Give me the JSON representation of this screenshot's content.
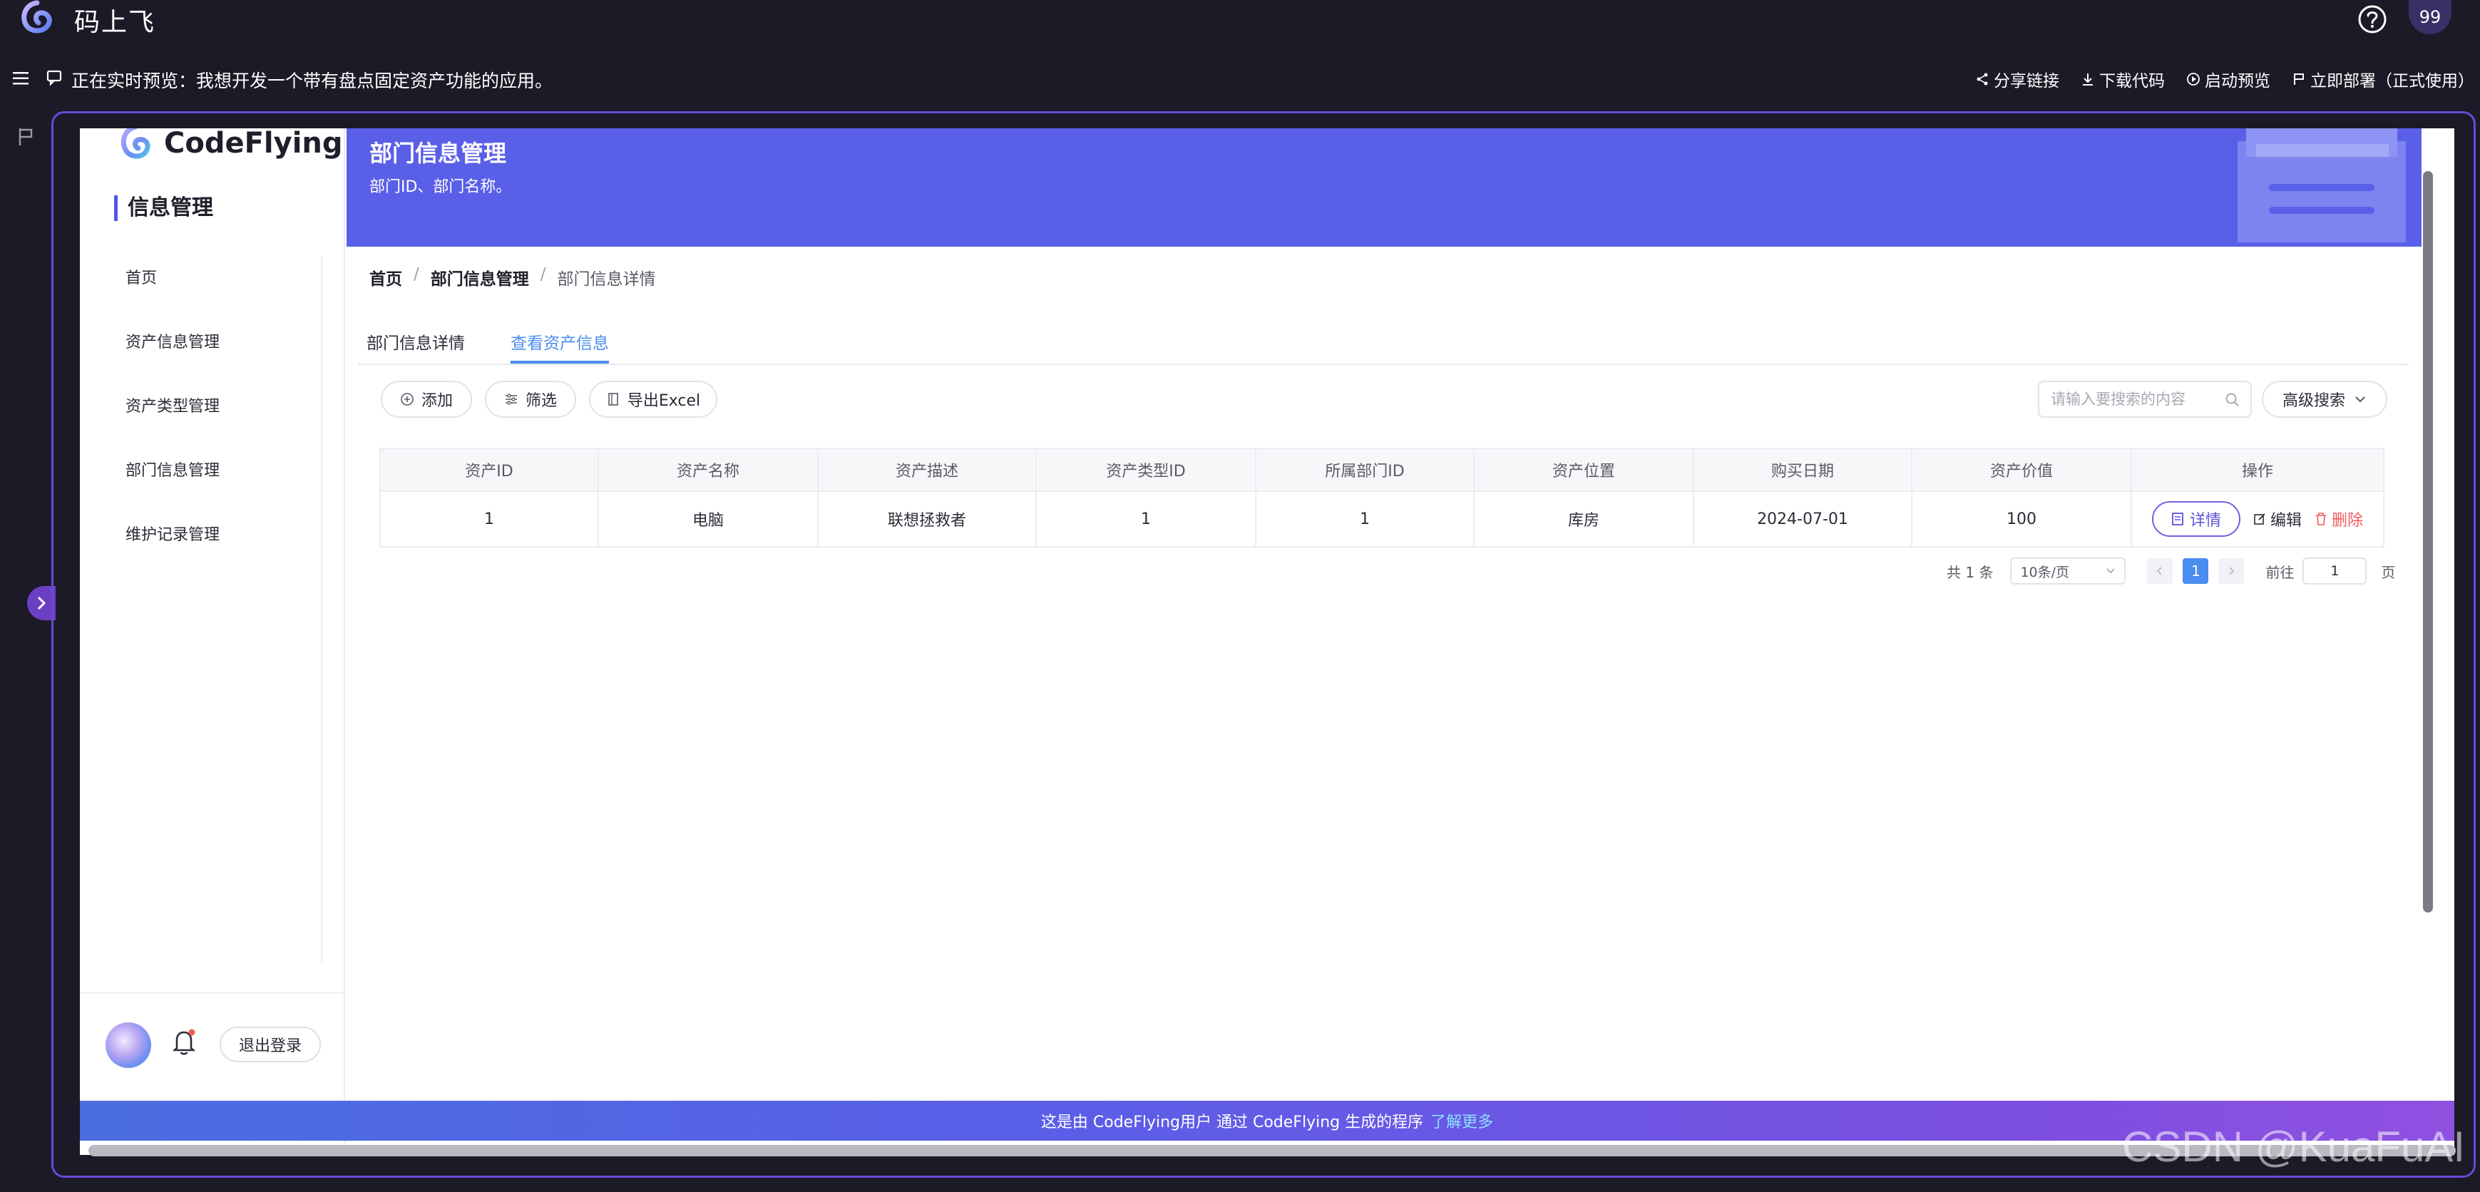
{
  "topbar": {
    "app_title": "码上飞",
    "avatar_text": "99"
  },
  "preview": {
    "text": "正在实时预览：我想开发一个带有盘点固定资产功能的应用。",
    "actions": [
      {
        "label": "分享链接",
        "icon": "share-icon"
      },
      {
        "label": "下载代码",
        "icon": "download-icon"
      },
      {
        "label": "启动预览",
        "icon": "play-icon"
      },
      {
        "label": "立即部署（正式使用）",
        "icon": "flag-icon"
      }
    ]
  },
  "sidebar": {
    "brand": "CodeFlying",
    "section_title": "信息管理",
    "items": [
      {
        "label": "首页"
      },
      {
        "label": "资产信息管理"
      },
      {
        "label": "资产类型管理"
      },
      {
        "label": "部门信息管理"
      },
      {
        "label": "维护记录管理"
      }
    ],
    "logout_label": "退出登录"
  },
  "banner": {
    "title": "部门信息管理",
    "subtitle": "部门ID、部门名称。"
  },
  "breadcrumb": [
    "首页",
    "部门信息管理",
    "部门信息详情"
  ],
  "tabs": [
    {
      "label": "部门信息详情",
      "active": false
    },
    {
      "label": "查看资产信息",
      "active": true
    }
  ],
  "toolbar": {
    "add_label": "添加",
    "filter_label": "筛选",
    "export_label": "导出Excel",
    "search_placeholder": "请输入要搜索的内容",
    "advanced_label": "高级搜索"
  },
  "table": {
    "columns": [
      "资产ID",
      "资产名称",
      "资产描述",
      "资产类型ID",
      "所属部门ID",
      "资产位置",
      "购买日期",
      "资产价值",
      "操作"
    ],
    "rows": [
      {
        "cells": [
          "1",
          "电脑",
          "联想拯救者",
          "1",
          "1",
          "库房",
          "2024-07-01",
          "100"
        ]
      }
    ],
    "ops": {
      "detail": "详情",
      "edit": "编辑",
      "delete": "删除"
    }
  },
  "pagination": {
    "total": "共 1 条",
    "page_size": "10条/页",
    "current_page": "1",
    "goto_prefix": "前往",
    "goto_value": "1",
    "goto_suffix": "页"
  },
  "footer": {
    "text": "这是由 CodeFlying用户 通过 CodeFlying 生成的程序",
    "link": "了解更多"
  },
  "watermark": "CSDN @KuaFuAI",
  "colors": {
    "accent": "#5a5fe8",
    "primary_link": "#4a8cf0",
    "danger": "#f05a5a",
    "background": "#1b1a26"
  }
}
